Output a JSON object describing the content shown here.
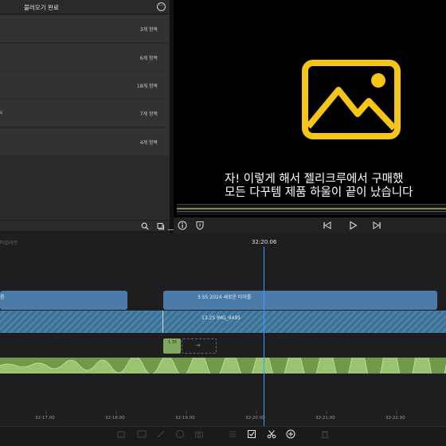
{
  "browser": {
    "title": "불러오기 완료",
    "more_icon": "ellipsis-circle-icon",
    "folders": [
      {
        "name": "",
        "count": "3개 항목"
      },
      {
        "name": "",
        "count": "6개 항목"
      },
      {
        "name": "",
        "count": "18개 항목"
      },
      {
        "name": "s",
        "count": "7개 항목"
      },
      {
        "name": "",
        "count": "4개 항목"
      }
    ],
    "footer_icons": [
      "search-icon",
      "sort-filter-icon"
    ]
  },
  "viewer": {
    "placeholder_icon": "image-placeholder-icon",
    "placeholder_color": "#f5c518",
    "caption_line1": "자! 이렇게 해서 젤리크루에서 구매했",
    "caption_line2": "모든 다꾸템 제품 하울이 끝이 났습니다",
    "controls": [
      "info-icon",
      "shield-icon",
      "skip-back-icon",
      "play-icon",
      "skip-forward-icon"
    ]
  },
  "timeline": {
    "label": "타임라인",
    "playhead_time": "32:20.06",
    "title_clips": [
      {
        "label": "름"
      },
      {
        "label": "3.55   2024 새로운 타이틀"
      }
    ],
    "video_clip_label": "13.25   IMG_9495",
    "small_clip_label": "1.35",
    "ruler_ticks": [
      "32:17.00",
      "32:18.00",
      "32:19.00",
      "32:20.00",
      "32:21.00",
      "32:22.00"
    ],
    "accent_color": "#3aa0ff"
  },
  "toolbar": {
    "tools": [
      "crop-icon",
      "filter-icon",
      "pen-icon",
      "clock-icon",
      "camera-icon",
      "list-icon",
      "checkbox-icon",
      "scissors-icon",
      "plus-circle-icon",
      "trash-icon"
    ]
  }
}
